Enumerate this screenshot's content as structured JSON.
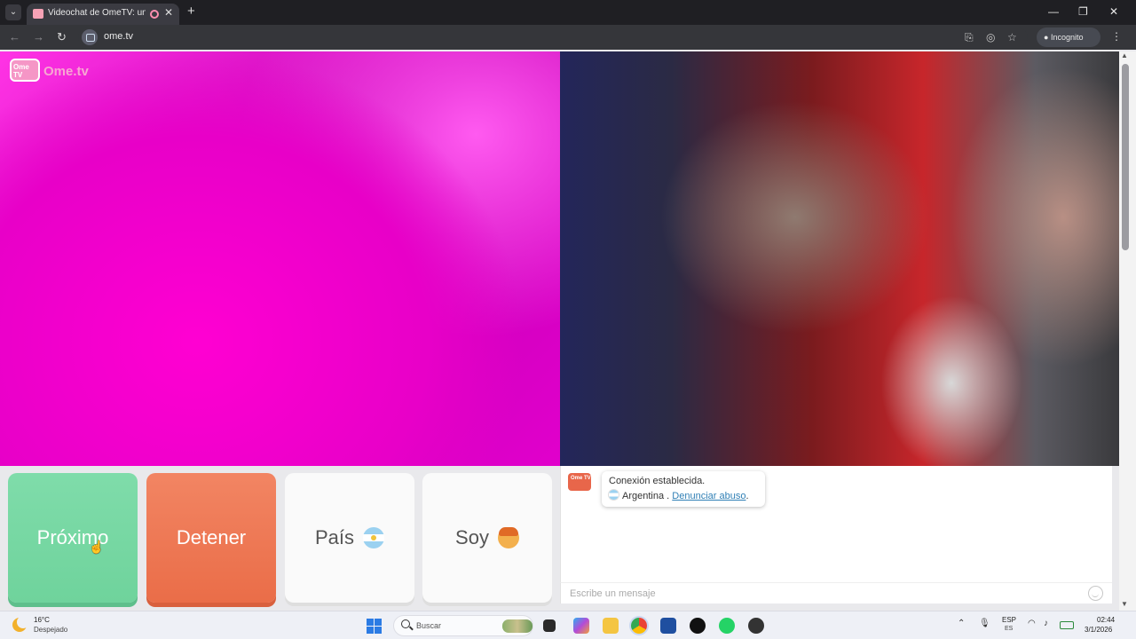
{
  "browser": {
    "tab_title": "Videochat de OmeTV: una",
    "tab_close": "✕",
    "new_tab": "+",
    "url": "ome.tv",
    "incognito_label": "Incognito",
    "window": {
      "minimize": "—",
      "restore": "❐",
      "close": "✕"
    },
    "nav": {
      "back": "←",
      "forward": "→",
      "reload": "↻"
    }
  },
  "site": {
    "logo_badge": "Ome TV",
    "logo_text": "Ome.tv"
  },
  "controls": {
    "next_label": "Próximo",
    "stop_label": "Detener",
    "country_label": "País",
    "gender_label": "Soy"
  },
  "chat": {
    "logo_badge": "Ome TV",
    "status": "Conexión establecida.",
    "country": "Argentina",
    "separator": ".",
    "report_link": "Denunciar abuso",
    "report_suffix": ".",
    "input_placeholder": "Escribe un mensaje"
  },
  "taskbar": {
    "temperature": "16°C",
    "weather": "Despejado",
    "search_label": "Buscar",
    "lang_top": "ESP",
    "lang_bottom": "ES",
    "time": "02:44",
    "date": "3/1/2026"
  },
  "colors": {
    "next_button": "#6fd39c",
    "stop_button": "#ea6d48",
    "link": "#2f7fb5",
    "left_video": "#e800c8"
  }
}
